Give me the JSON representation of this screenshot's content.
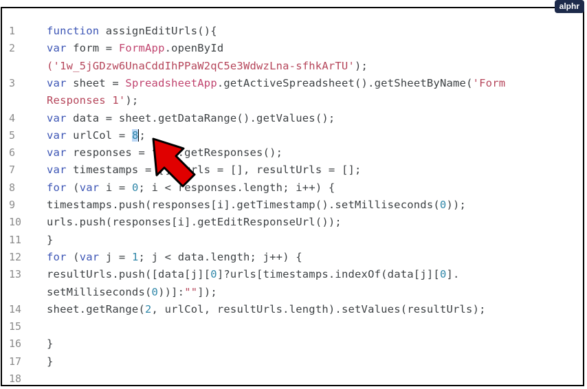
{
  "brand": {
    "label": "alphr"
  },
  "colors": {
    "keyword": "#3c55b5",
    "string": "#b5455a",
    "class": "#c0436e",
    "number": "#2e86a8",
    "arrow": "#e00000"
  },
  "icons": {
    "annotation": "red-arrow-icon"
  },
  "lines": [
    {
      "n": "1",
      "parts": [
        {
          "t": "function",
          "c": "kw"
        },
        {
          "t": " assignEditUrls(){"
        }
      ]
    },
    {
      "n": "2",
      "parts": [
        {
          "t": "var",
          "c": "kw"
        },
        {
          "t": " form = "
        },
        {
          "t": "FormApp",
          "c": "cls"
        },
        {
          "t": ".openById"
        }
      ]
    },
    {
      "n": "",
      "parts": [
        {
          "t": "('1w_5jGDzw6UnaCddIhPPaW2qC5e3WdwzLna-sfhkArTU'",
          "c": "str"
        },
        {
          "t": ");"
        }
      ]
    },
    {
      "n": "3",
      "parts": [
        {
          "t": "var",
          "c": "kw"
        },
        {
          "t": " sheet = "
        },
        {
          "t": "SpreadsheetApp",
          "c": "cls"
        },
        {
          "t": ".getActiveSpreadsheet().getSheetByName("
        },
        {
          "t": "'Form",
          "c": "str"
        }
      ]
    },
    {
      "n": "",
      "parts": [
        {
          "t": "Responses 1'",
          "c": "str"
        },
        {
          "t": ");"
        }
      ]
    },
    {
      "n": "4",
      "parts": [
        {
          "t": "var",
          "c": "kw"
        },
        {
          "t": " data = sheet.getDataRange().getValues();"
        }
      ]
    },
    {
      "n": "5",
      "parts": [
        {
          "t": "var",
          "c": "kw"
        },
        {
          "t": " urlCol = "
        },
        {
          "t": "8",
          "c": "sel"
        },
        {
          "t": "",
          "c": "caret"
        },
        {
          "t": ";"
        }
      ]
    },
    {
      "n": "6",
      "parts": [
        {
          "t": "var",
          "c": "kw"
        },
        {
          "t": " responses = form.getResponses();"
        }
      ]
    },
    {
      "n": "7",
      "parts": [
        {
          "t": "var",
          "c": "kw"
        },
        {
          "t": " timestamps = [], urls = [], resultUrls = [];"
        }
      ]
    },
    {
      "n": "8",
      "parts": [
        {
          "t": "for",
          "c": "kw"
        },
        {
          "t": " ("
        },
        {
          "t": "var",
          "c": "kw"
        },
        {
          "t": " i = "
        },
        {
          "t": "0",
          "c": "num"
        },
        {
          "t": "; i < responses.length; i++) {"
        }
      ]
    },
    {
      "n": "9",
      "parts": [
        {
          "t": "timestamps.push(responses[i].getTimestamp().setMilliseconds("
        },
        {
          "t": "0",
          "c": "num"
        },
        {
          "t": "));"
        }
      ]
    },
    {
      "n": "10",
      "parts": [
        {
          "t": "urls.push(responses[i].getEditResponseUrl());"
        }
      ]
    },
    {
      "n": "11",
      "parts": [
        {
          "t": "}"
        }
      ]
    },
    {
      "n": "12",
      "parts": [
        {
          "t": "for",
          "c": "kw"
        },
        {
          "t": " ("
        },
        {
          "t": "var",
          "c": "kw"
        },
        {
          "t": " j = "
        },
        {
          "t": "1",
          "c": "num"
        },
        {
          "t": "; j < data.length; j++) {"
        }
      ]
    },
    {
      "n": "13",
      "parts": [
        {
          "t": "resultUrls.push([data[j]["
        },
        {
          "t": "0",
          "c": "num"
        },
        {
          "t": "]?urls[timestamps.indexOf(data[j]["
        },
        {
          "t": "0",
          "c": "num"
        },
        {
          "t": "]."
        }
      ]
    },
    {
      "n": "",
      "parts": [
        {
          "t": "setMilliseconds("
        },
        {
          "t": "0",
          "c": "num"
        },
        {
          "t": "))]:"
        },
        {
          "t": "\"\"",
          "c": "str"
        },
        {
          "t": "]);"
        }
      ]
    },
    {
      "n": "14",
      "parts": [
        {
          "t": "sheet.getRange("
        },
        {
          "t": "2",
          "c": "num"
        },
        {
          "t": ", urlCol, resultUrls.length).setValues(resultUrls);"
        }
      ]
    },
    {
      "n": "15",
      "parts": [
        {
          "t": ""
        }
      ]
    },
    {
      "n": "16",
      "parts": [
        {
          "t": "}"
        }
      ]
    },
    {
      "n": "17",
      "parts": [
        {
          "t": "}"
        }
      ]
    },
    {
      "n": "18",
      "parts": [
        {
          "t": ""
        }
      ]
    }
  ]
}
